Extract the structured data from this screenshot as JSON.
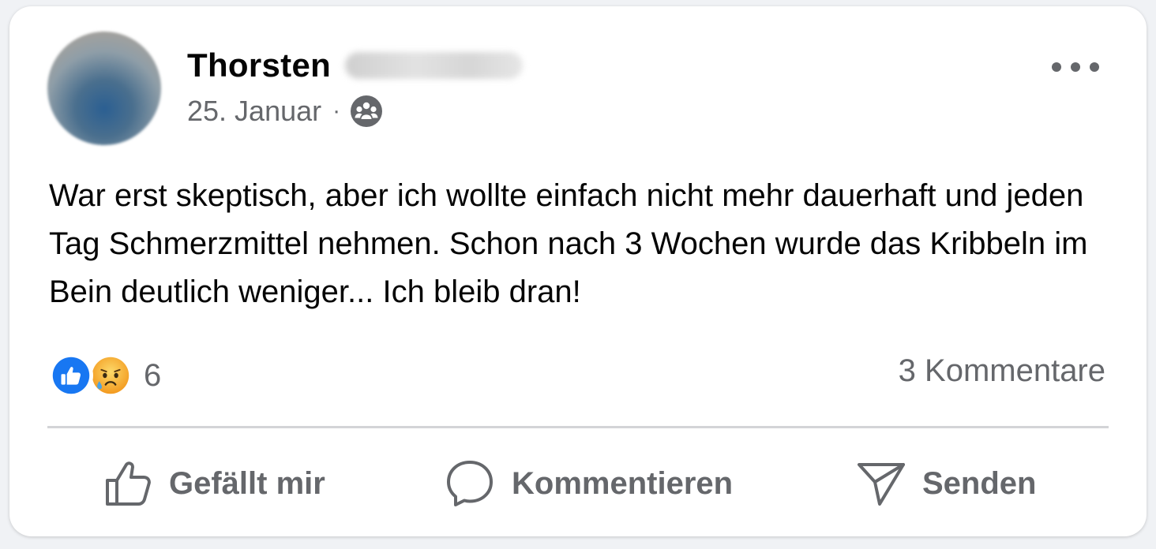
{
  "post": {
    "author_first_name": "Thorsten",
    "date": "25. Januar",
    "separator": "·",
    "audience_icon": "group-icon",
    "text": "War erst skeptisch, aber ich wollte einfach nicht mehr dauerhaft und jeden Tag Schmerzmittel nehmen. Schon nach 3 Wochen wurde das Kribbeln im Bein deutlich weniger... Ich bleib dran!"
  },
  "reactions": {
    "types": [
      "like",
      "sad"
    ],
    "count": "6"
  },
  "comments": {
    "count_label": "3 Kommentare"
  },
  "actions": {
    "like_label": "Gefällt mir",
    "comment_label": "Kommentieren",
    "send_label": "Senden"
  },
  "colors": {
    "like_blue": "#1877f2",
    "sad_yellow": "#f7b125",
    "secondary_text": "#65676b",
    "primary_text": "#050505"
  }
}
